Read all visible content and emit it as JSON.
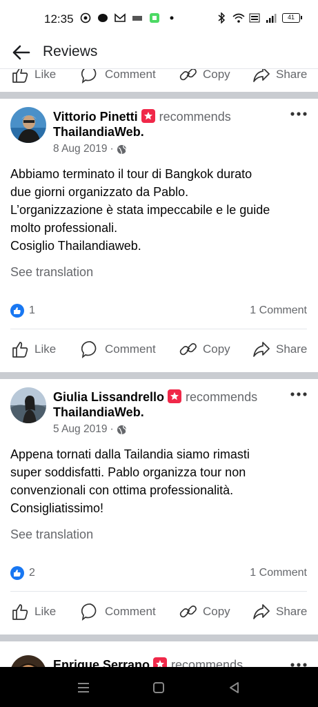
{
  "status": {
    "time": "12:35",
    "battery": "41"
  },
  "header": {
    "title": "Reviews"
  },
  "actions": {
    "like": "Like",
    "comment": "Comment",
    "copy": "Copy",
    "share": "Share"
  },
  "posts": [
    {
      "author": "Vittorio Pinetti",
      "recommends": "recommends",
      "page": "ThailandiaWeb",
      "page_suffix": ".",
      "date": "8 Aug 2019",
      "date_sep": "·",
      "text": [
        "Abbiamo terminato il tour di Bangkok durato",
        "due giorni organizzato da Pablo.",
        "L’organizzazione è stata impeccabile e le guide",
        "molto professionali.",
        "Cosiglio Thailandiaweb."
      ],
      "see_translation": "See translation",
      "likes": "1",
      "comments": "1 Comment"
    },
    {
      "author": "Giulia Lissandrello",
      "recommends": "recommends",
      "page": "ThailandiaWeb",
      "page_suffix": ".",
      "date": "5 Aug 2019",
      "date_sep": "·",
      "text": [
        "Appena tornati dalla Tailandia siamo rimasti",
        "super soddisfatti. Pablo organizza tour non",
        "convenzionali con ottima professionalità.",
        "Consigliatissimo!"
      ],
      "see_translation": "See translation",
      "likes": "2",
      "comments": "1 Comment"
    },
    {
      "author": "Enrique Serrano",
      "recommends": "recommends"
    }
  ],
  "colors": {
    "accent": "#1877f2",
    "recommend_badge": "#f02849",
    "secondary_text": "#65676b",
    "divider": "#c9ccd1"
  }
}
